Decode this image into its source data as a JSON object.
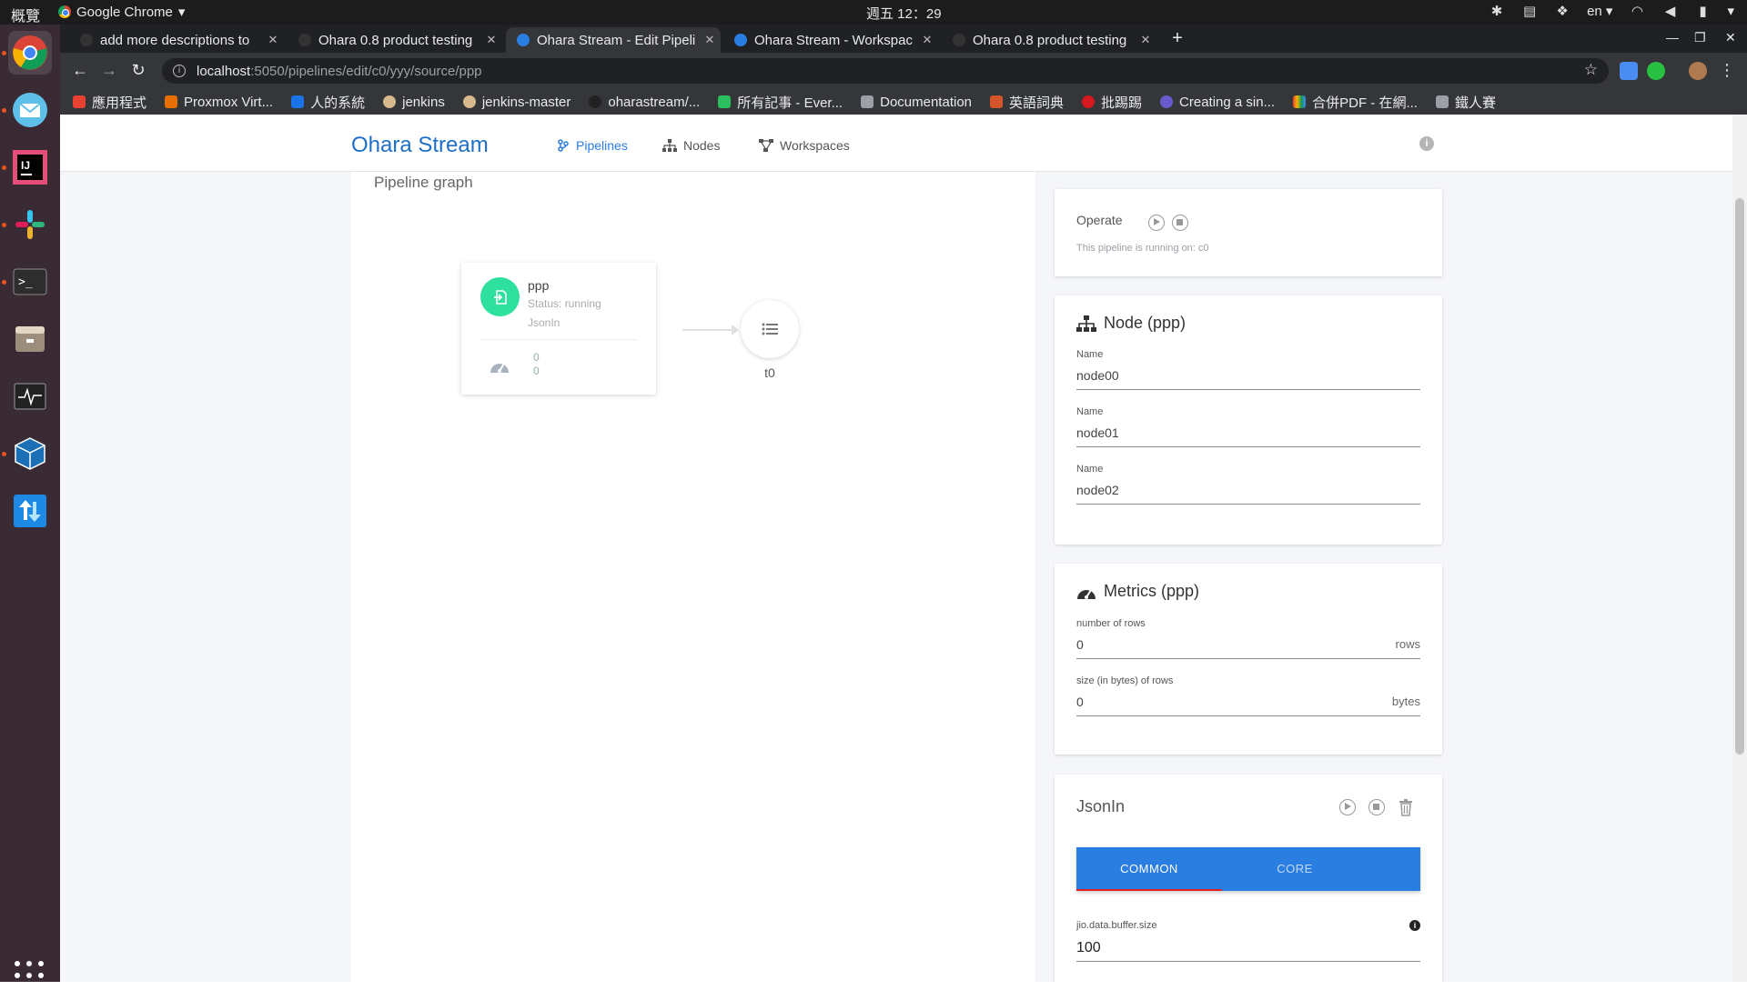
{
  "os": {
    "activities": "概覽",
    "app_menu": "Google Chrome",
    "clock": "週五 12：29",
    "keyboard_layout": "en"
  },
  "browser": {
    "tabs": [
      {
        "title": "add more descriptions to",
        "favicon": "github-icon",
        "active": false
      },
      {
        "title": "Ohara 0.8 product testing",
        "favicon": "github-icon",
        "active": false
      },
      {
        "title": "Ohara Stream - Edit Pipeli",
        "favicon": "globe-icon",
        "active": true
      },
      {
        "title": "Ohara Stream - Workspac",
        "favicon": "globe-icon",
        "active": false
      },
      {
        "title": "Ohara 0.8 product testing",
        "favicon": "github-icon",
        "active": false
      }
    ],
    "url_host": "localhost",
    "url_path": ":5050/pipelines/edit/c0/yyy/source/ppp",
    "bookmarks": [
      {
        "label": "應用程式",
        "color": "#e94235"
      },
      {
        "label": "Proxmox Virt...",
        "color": "#e57000"
      },
      {
        "label": "人的系統",
        "color": "#1a73e8"
      },
      {
        "label": "jenkins",
        "color": "#d9b88f"
      },
      {
        "label": "jenkins-master",
        "color": "#d9b88f"
      },
      {
        "label": "oharastream/...",
        "color": "#222222"
      },
      {
        "label": "所有記事 - Ever...",
        "color": "#2dbe60"
      },
      {
        "label": "Documentation",
        "color": "#9aa0a6"
      },
      {
        "label": "英語詞典",
        "color": "#d4542b"
      },
      {
        "label": "批踢踢",
        "color": "#d71920"
      },
      {
        "label": "Creating a sin...",
        "color": "#6a5acd"
      },
      {
        "label": "合併PDF - 在網...",
        "color": "#f4b400"
      },
      {
        "label": "鐵人賽",
        "color": "#9aa0a6"
      }
    ]
  },
  "app": {
    "brand": "Ohara Stream",
    "nav": {
      "pipelines": "Pipelines",
      "nodes": "Nodes",
      "workspaces": "Workspaces"
    },
    "accent": "#2a7de1"
  },
  "graph": {
    "title": "Pipeline graph",
    "source_node": {
      "name": "ppp",
      "status": "Status: running",
      "kind": "JsonIn",
      "metric_1": "0",
      "metric_2": "0",
      "color": "#2ee09d"
    },
    "topic_node": {
      "name": "t0"
    }
  },
  "sidebar": {
    "operate": {
      "title": "Operate",
      "info": "This pipeline is running on: c0"
    },
    "node_card": {
      "title": "Node (ppp)",
      "fields": [
        {
          "label": "Name",
          "value": "node00"
        },
        {
          "label": "Name",
          "value": "node01"
        },
        {
          "label": "Name",
          "value": "node02"
        }
      ]
    },
    "metrics_card": {
      "title": "Metrics (ppp)",
      "rows": {
        "label": "number of rows",
        "value": "0",
        "unit": "rows"
      },
      "size": {
        "label": "size (in bytes) of rows",
        "value": "0",
        "unit": "bytes"
      }
    },
    "connector_card": {
      "title": "JsonIn",
      "tabs": {
        "common": "COMMON",
        "core": "CORE"
      },
      "field": {
        "label": "jio.data.buffer.size",
        "value": "100"
      }
    }
  }
}
